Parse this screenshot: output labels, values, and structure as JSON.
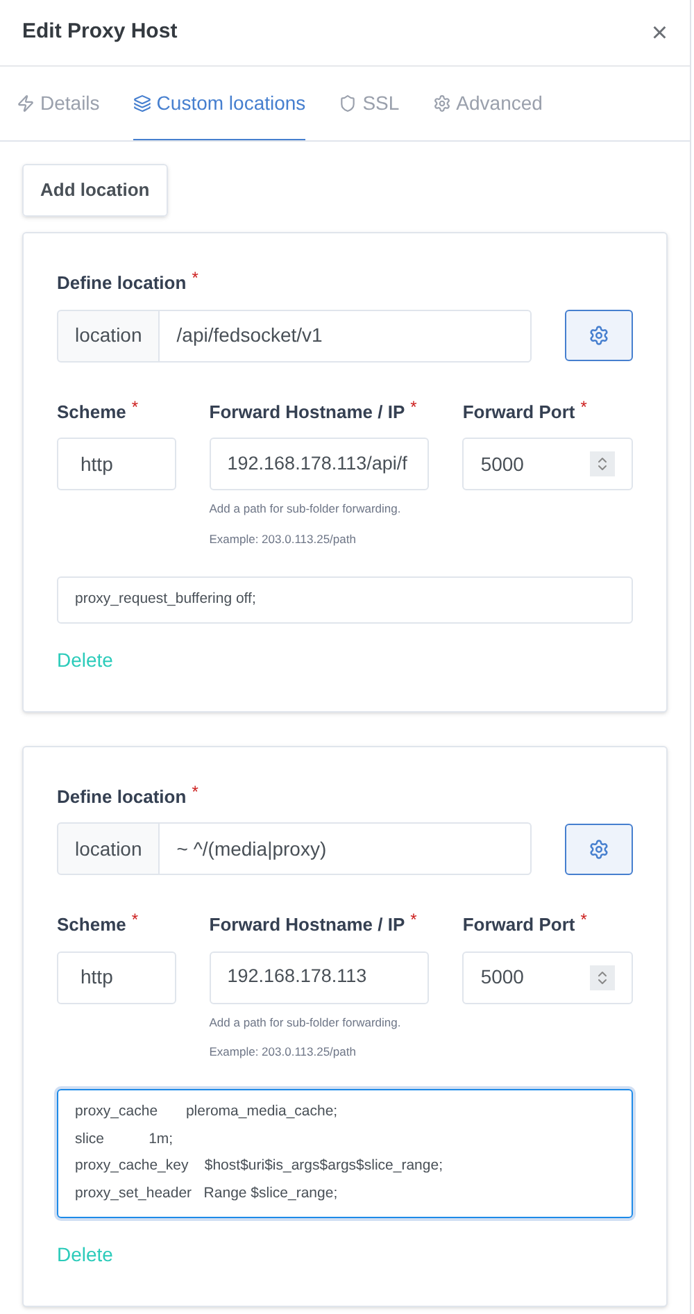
{
  "window": {
    "title": "Edit Proxy Host",
    "close": "×"
  },
  "tabs": [
    {
      "label": "Details",
      "kind": "bolt",
      "selected": false
    },
    {
      "label": "Custom locations",
      "kind": "layers",
      "selected": true
    },
    {
      "label": "SSL",
      "kind": "shield",
      "selected": false
    },
    {
      "label": "Advanced",
      "kind": "gear",
      "selected": false
    }
  ],
  "add_button": "Add location",
  "locations": [
    {
      "define_label": "Define location",
      "addon": "location",
      "path": "/api/fedsocket/v1",
      "scheme_label": "Scheme",
      "scheme": "http",
      "host_label": "Forward Hostname / IP",
      "host": "192.168.178.113/api/f",
      "port_label": "Forward Port",
      "port": "5000",
      "hint": "Add a path for sub-folder forwarding.",
      "example": "Example: 203.0.113.25/path",
      "config": [
        "proxy_request_buffering off;"
      ],
      "focused": false,
      "delete": "Delete"
    },
    {
      "define_label": "Define location",
      "addon": "location",
      "path": "~ ^/(media|proxy)",
      "scheme_label": "Scheme",
      "scheme": "http",
      "host_label": "Forward Hostname / IP",
      "host": "192.168.178.113",
      "port_label": "Forward Port",
      "port": "5000",
      "hint": "Add a path for sub-folder forwarding.",
      "example": "Example: 203.0.113.25/path",
      "config": [
        "proxy_cache       pleroma_media_cache;",
        "slice           1m;",
        "proxy_cache_key    $host$uri$is_args$args$slice_range;",
        "proxy_set_header   Range $slice_range;"
      ],
      "focused": true,
      "delete": "Delete"
    }
  ],
  "required_mark": "*"
}
